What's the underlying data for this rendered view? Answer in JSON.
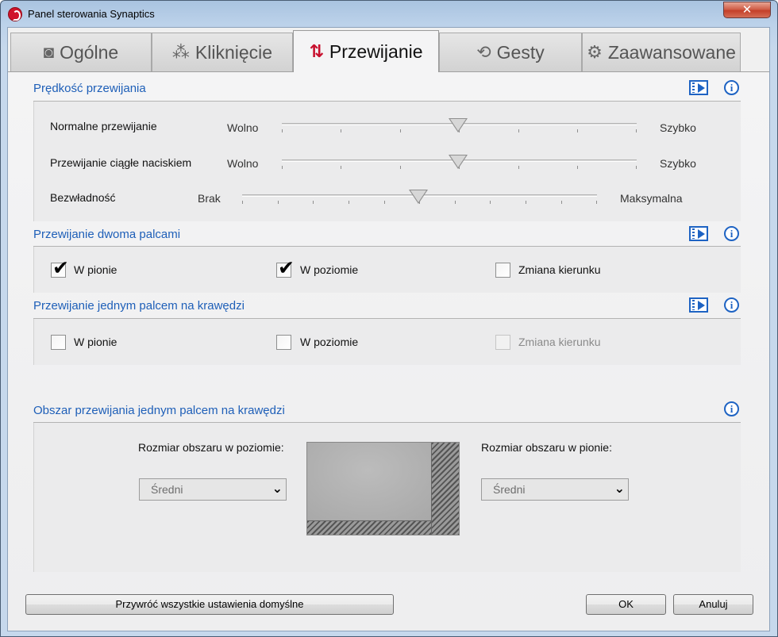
{
  "window": {
    "title": "Panel sterowania Synaptics",
    "close_label": "✕"
  },
  "tabs": [
    {
      "label": "Ogólne",
      "icon": "touchpad-icon"
    },
    {
      "label": "Kliknięcie",
      "icon": "click-icon"
    },
    {
      "label": "Przewijanie",
      "icon": "scroll-arrows-icon",
      "active": true
    },
    {
      "label": "Gesty",
      "icon": "gesture-icon"
    },
    {
      "label": "Zaawansowane",
      "icon": "gear-icon"
    }
  ],
  "scroll_speed": {
    "title": "Prędkość przewijania",
    "sliders": [
      {
        "label": "Normalne przewijanie",
        "min_label": "Wolno",
        "max_label": "Szybko",
        "value": 0.5
      },
      {
        "label": "Przewijanie ciągłe naciskiem",
        "min_label": "Wolno",
        "max_label": "Szybko",
        "value": 0.5
      },
      {
        "label": "Bezwładność",
        "min_label": "Brak",
        "max_label": "Maksymalna",
        "value": 0.5
      }
    ]
  },
  "two_finger": {
    "title": "Przewijanie dwoma palcami",
    "options": [
      {
        "label": "W pionie",
        "checked": true
      },
      {
        "label": "W poziomie",
        "checked": true
      },
      {
        "label": "Zmiana kierunku",
        "checked": false
      }
    ]
  },
  "edge_scroll": {
    "title": "Przewijanie jednym palcem na krawędzi",
    "options": [
      {
        "label": "W pionie",
        "checked": false
      },
      {
        "label": "W poziomie",
        "checked": false
      },
      {
        "label": "Zmiana kierunku",
        "checked": false,
        "disabled": true
      }
    ]
  },
  "edge_area": {
    "title": "Obszar przewijania jednym palcem na krawędzi",
    "horizontal_label": "Rozmiar obszaru w poziomie:",
    "horizontal_value": "Średni",
    "vertical_label": "Rozmiar obszaru w pionie:",
    "vertical_value": "Średni"
  },
  "footer": {
    "reset_label": "Przywróć wszystkie ustawienia domyślne",
    "ok_label": "OK",
    "cancel_label": "Anuluj"
  },
  "colors": {
    "accent": "#1e5fb8",
    "active_tab_icon": "#c8102e",
    "close_button": "#c4402a"
  }
}
